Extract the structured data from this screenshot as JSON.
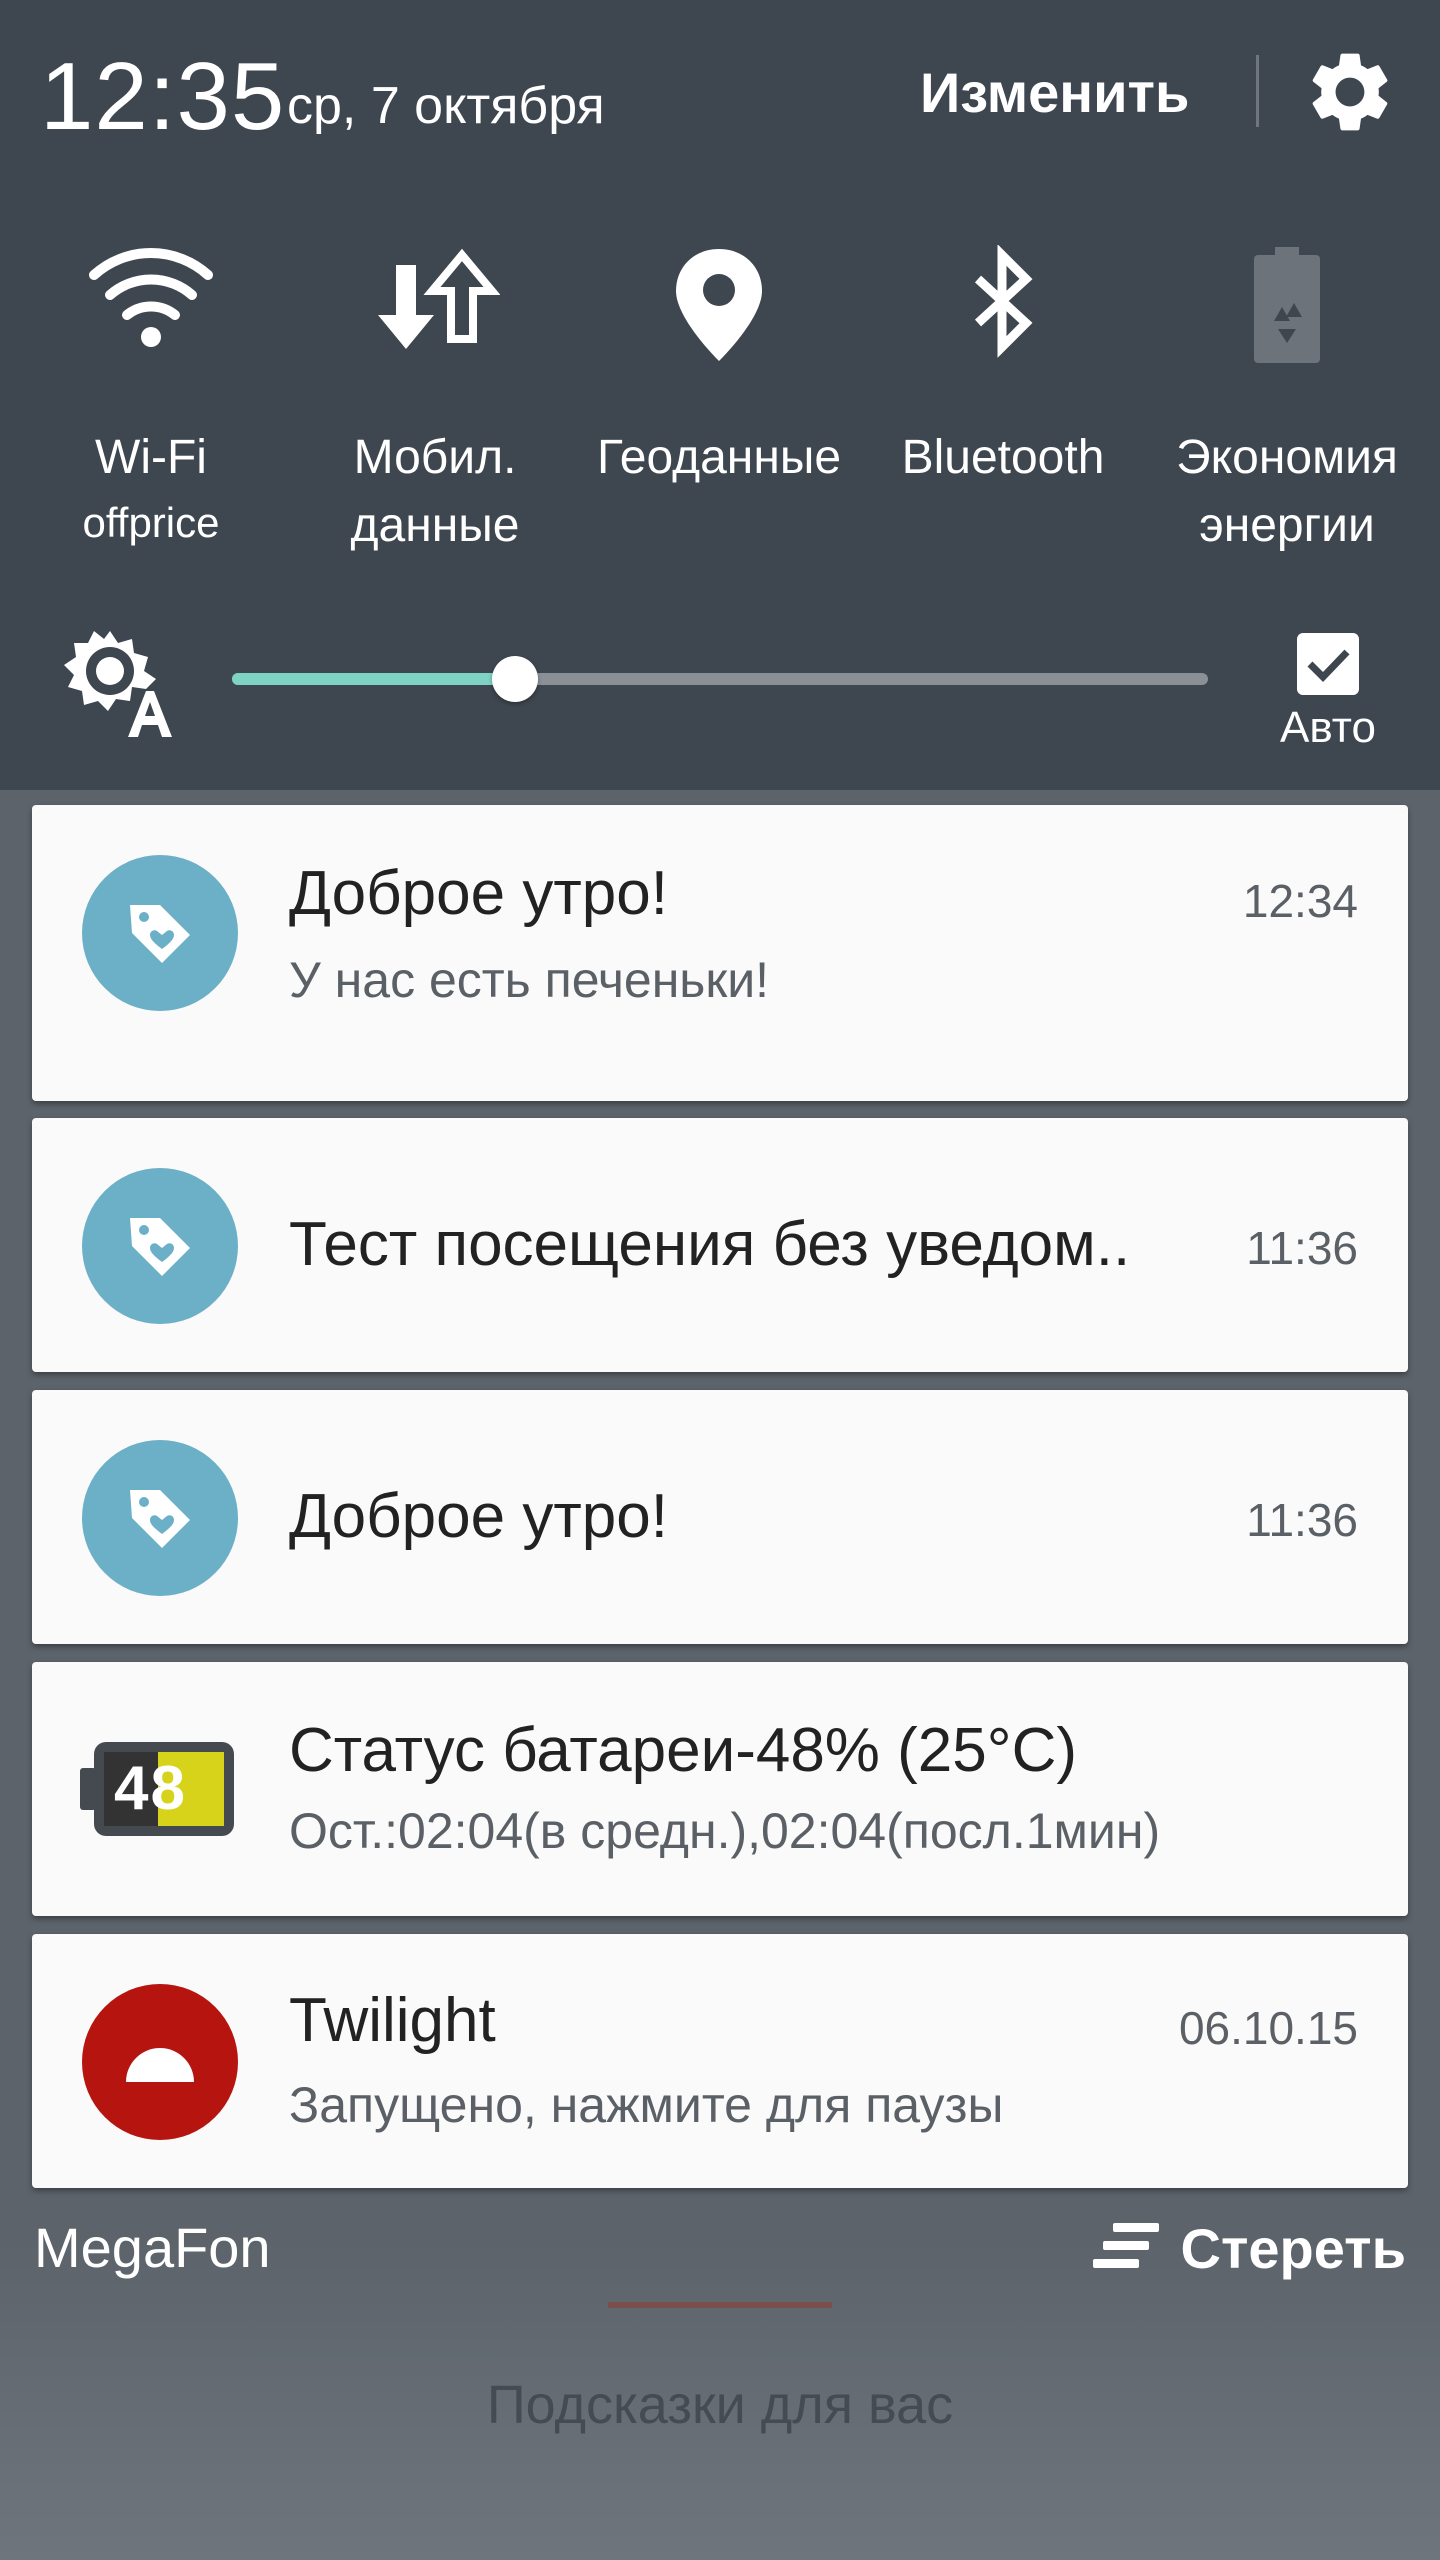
{
  "header": {
    "time": "12:35",
    "date": "ср, 7 октября",
    "edit_label": "Изменить",
    "settings_icon": "gear-icon"
  },
  "quick_settings": [
    {
      "id": "wifi",
      "icon": "wifi-icon",
      "line1": "Wi-Fi",
      "line2": "offprice",
      "active": true
    },
    {
      "id": "mobile-data",
      "icon": "mobile-data-icon",
      "line1": "Мобил.",
      "line2": "данные",
      "active": true
    },
    {
      "id": "location",
      "icon": "location-pin-icon",
      "line1": "Геоданные",
      "line2": "",
      "active": true
    },
    {
      "id": "bluetooth",
      "icon": "bluetooth-icon",
      "line1": "Bluetooth",
      "line2": "",
      "active": true
    },
    {
      "id": "power-saving",
      "icon": "power-saving-icon",
      "line1": "Экономия",
      "line2": "энергии",
      "active": false
    }
  ],
  "brightness": {
    "level": 0.29,
    "auto_label": "Авто",
    "auto_checked": true,
    "icon": "auto-brightness-icon",
    "accent": "#7fd3c4"
  },
  "notifications": [
    {
      "icon": "tag-heart-icon",
      "title": "Доброе утро!",
      "text": "У нас есть печеньки!",
      "time": "12:34"
    },
    {
      "icon": "tag-heart-icon",
      "title": "Тест посещения без уведом..",
      "text": "",
      "time": "11:36"
    },
    {
      "icon": "tag-heart-icon",
      "title": "Доброе утро!",
      "text": "",
      "time": "11:36"
    },
    {
      "icon": "battery-icon",
      "battery_value": "48",
      "title": "Статус батареи-48% (25°C)",
      "text": "Ост.:02:04(в средн.),02:04(посл.1мин)",
      "time": ""
    },
    {
      "icon": "twilight-icon",
      "title": "Twilight",
      "text": "Запущено, нажмите для паузы",
      "time": "06.10.15"
    }
  ],
  "footer": {
    "carrier": "MegaFon",
    "clear_label": "Стереть",
    "hints_label": "Подсказки для вас"
  },
  "colors": {
    "panel": "#3e464f",
    "notification_icon": "#6cb0c7",
    "twilight_icon": "#b5140f"
  }
}
